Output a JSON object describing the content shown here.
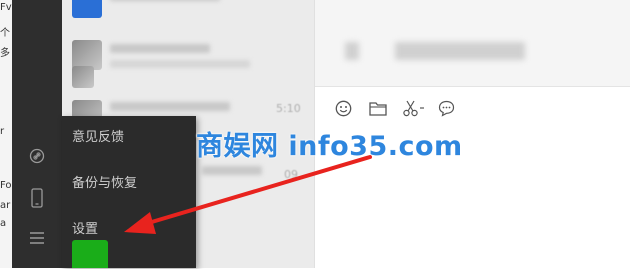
{
  "menu": {
    "items": [
      {
        "label": "意见反馈"
      },
      {
        "label": "备份与恢复"
      },
      {
        "label": "设置"
      }
    ]
  },
  "chat_list": {
    "rows": [
      {
        "time": ""
      },
      {
        "time": ""
      },
      {
        "time": "5:10"
      },
      {
        "time": "09"
      }
    ]
  },
  "background_window": {
    "fragments": [
      "Fv",
      "个",
      "多",
      "r",
      "Fo",
      "ar",
      "a"
    ]
  },
  "watermark": {
    "text": "商娱网 info35.com"
  },
  "colors": {
    "sidebar": "#2e2e2e",
    "menu": "#2b2b2b",
    "menu_text": "#cfcfcf",
    "watermark": "#2e86de",
    "arrow": "#e8231e",
    "brand_green": "#1aad19"
  },
  "icons": {
    "toolbar": [
      "emoji-icon",
      "folder-icon",
      "scissors-icon",
      "chat-bubble-icon"
    ],
    "sidebar": [
      "link-icon",
      "phone-icon",
      "menu-icon"
    ]
  }
}
